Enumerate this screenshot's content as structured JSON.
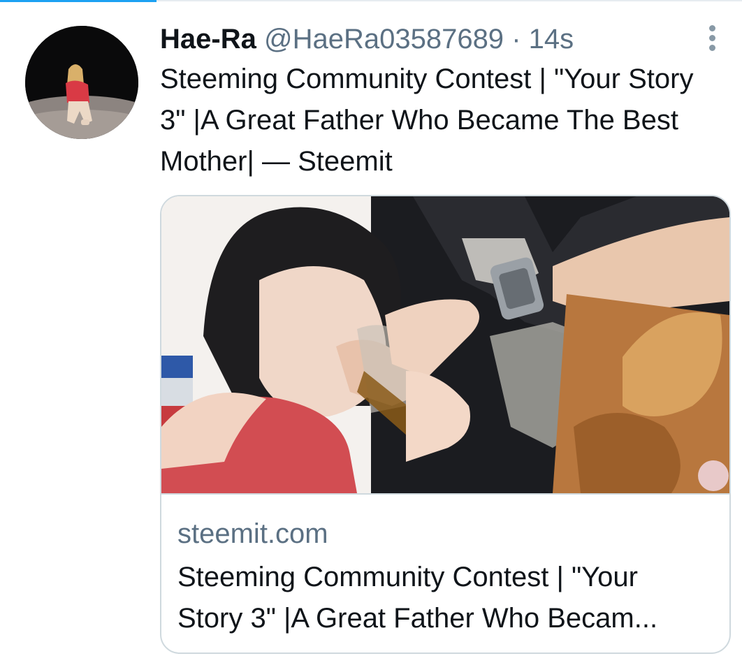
{
  "tweet": {
    "display_name": "Hae-Ra",
    "handle": "@HaeRa03587689",
    "separator": "·",
    "time": "14s",
    "text": "Steeming Community Contest | \"Your Story 3\" |A Great Father Who Became The Best Mother| — Steemit",
    "avatar_icon": "profile-photo",
    "more_icon": "more-vertical-icon"
  },
  "card": {
    "image_icon": "link-preview-photo",
    "domain": "steemit.com",
    "title_line1": "Steeming Community Contest | \"Your",
    "title_line2": "Story 3\" |A Great Father Who Becam..."
  },
  "colors": {
    "primary_text": "#0f1419",
    "secondary_text": "#5b7083",
    "border": "#cfd9de",
    "accent": "#1da1f2"
  }
}
